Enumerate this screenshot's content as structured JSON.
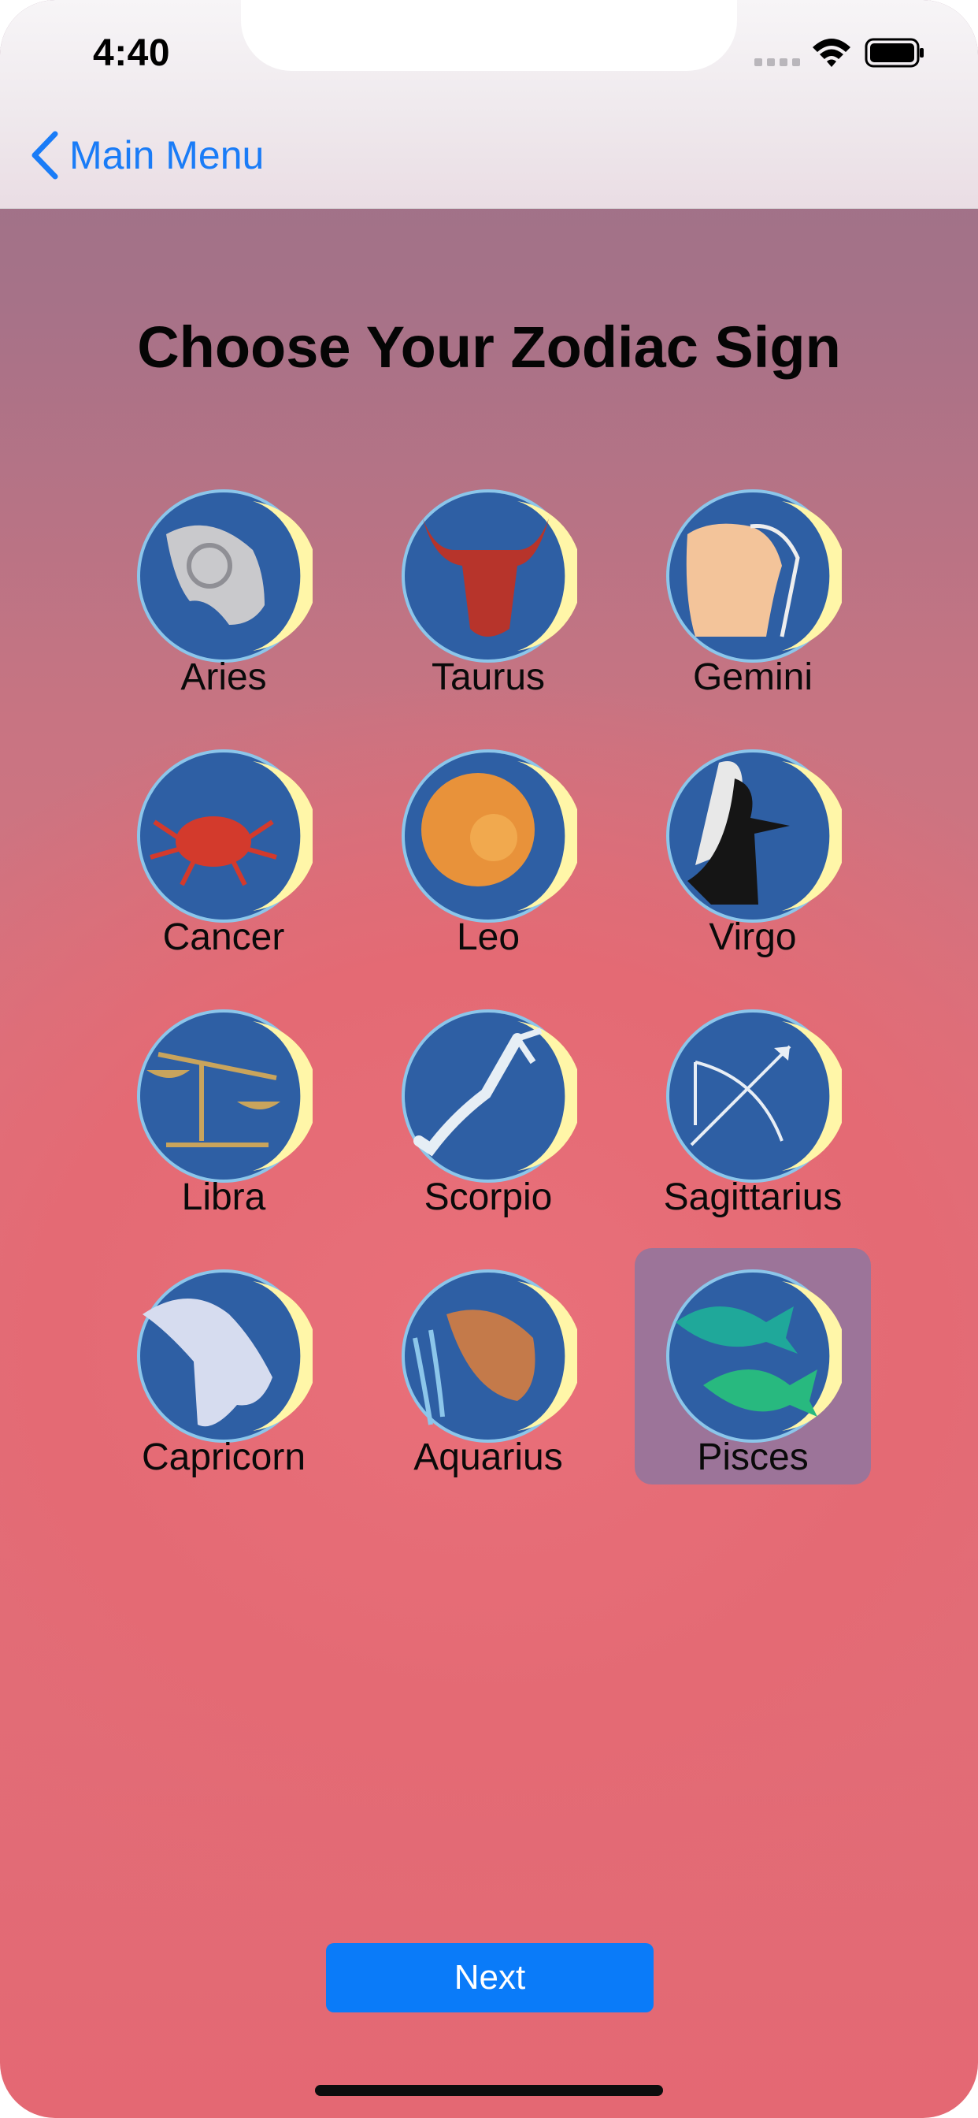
{
  "status_bar": {
    "time": "4:40"
  },
  "nav": {
    "back_label": "Main Menu",
    "back_icon": "chevron-left-icon"
  },
  "title": "Choose Your Zodiac Sign",
  "signs": [
    {
      "label": "Aries",
      "icon": "ram-icon",
      "selected": false
    },
    {
      "label": "Taurus",
      "icon": "bull-icon",
      "selected": false
    },
    {
      "label": "Gemini",
      "icon": "twins-icon",
      "selected": false
    },
    {
      "label": "Cancer",
      "icon": "crab-icon",
      "selected": false
    },
    {
      "label": "Leo",
      "icon": "lion-icon",
      "selected": false
    },
    {
      "label": "Virgo",
      "icon": "maiden-icon",
      "selected": false
    },
    {
      "label": "Libra",
      "icon": "scales-icon",
      "selected": false
    },
    {
      "label": "Scorpio",
      "icon": "scorpion-icon",
      "selected": false
    },
    {
      "label": "Sagittarius",
      "icon": "archer-icon",
      "selected": false
    },
    {
      "label": "Capricorn",
      "icon": "goat-icon",
      "selected": false
    },
    {
      "label": "Aquarius",
      "icon": "water-bearer-icon",
      "selected": false
    },
    {
      "label": "Pisces",
      "icon": "fish-icon",
      "selected": true
    }
  ],
  "next_button": {
    "label": "Next"
  },
  "colors": {
    "accent": "#0a7bf9",
    "selected_cell": "#9c7499",
    "medal_blue": "#2e5fa4",
    "medal_moon": "#fff6a8"
  }
}
